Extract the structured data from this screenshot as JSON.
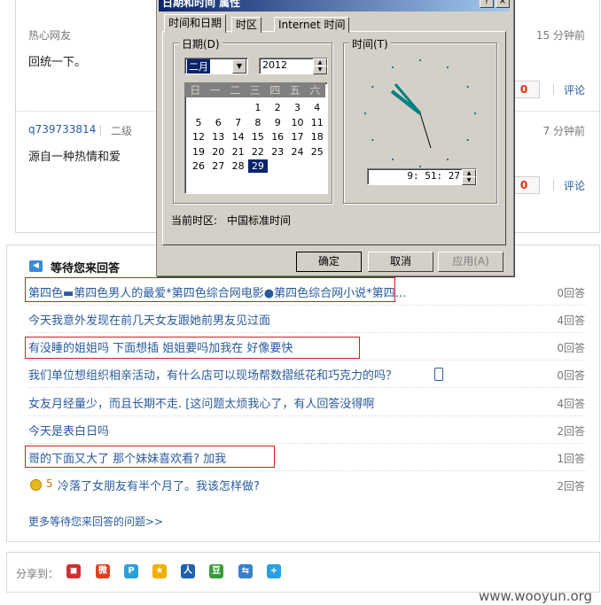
{
  "answers": [
    {
      "user": "热心网友",
      "level": "",
      "time": "15 分钟前",
      "text": "回统一下。",
      "vote": "0",
      "comment": "评论"
    },
    {
      "user": "q739733814",
      "level": "二级",
      "time": "7 分钟前",
      "text": "源自一种热情和爱",
      "vote": "0",
      "comment": "评论"
    }
  ],
  "pending": {
    "title": "等待您来回答",
    "questions": [
      {
        "text": "第四色▬第四色男人的最爱*第四色综合网电影●第四色综合网小说*第四…",
        "count": "0回答"
      },
      {
        "text": "今天我意外发现在前几天女友跟她前男友见过面",
        "count": "4回答"
      },
      {
        "text": "有没睡的姐姐吗 下面想插 姐姐要吗加我在 好像要快",
        "count": "0回答"
      },
      {
        "text": "我们单位想组织相亲活动，有什么店可以现场帮数摺纸花和巧克力的吗？",
        "count": "0回答"
      },
      {
        "text": "女友月经量少，而且长期不走. [这问题太烦我心了，有人回答没得啊",
        "count": "4回答"
      },
      {
        "text": "今天是表白日吗",
        "count": "2回答"
      },
      {
        "text": "哥的下面又大了 那个妹妹喜欢看? 加我",
        "count": "1回答"
      },
      {
        "text": "冷落了女朋友有半个月了。我该怎样做?",
        "count": "2回答",
        "reward": "5"
      }
    ],
    "more": "更多等待您来回答的问题>>"
  },
  "share": {
    "label": "分享到："
  },
  "watermark": "www.wooyun.org",
  "dialog": {
    "title": "日期和时间 属性",
    "tabs": [
      "时间和日期",
      "时区",
      "Internet 时间"
    ],
    "date_group": "日期(D)",
    "time_group": "时间(T)",
    "month": "二月",
    "year": "2012",
    "weekdays": [
      "日",
      "一",
      "二",
      "三",
      "四",
      "五",
      "六"
    ],
    "days": [
      "1",
      "2",
      "3",
      "4",
      "5",
      "6",
      "7",
      "8",
      "9",
      "10",
      "11",
      "12",
      "13",
      "14",
      "15",
      "16",
      "17",
      "18",
      "19",
      "20",
      "21",
      "22",
      "23",
      "24",
      "25",
      "26",
      "27",
      "28",
      "29"
    ],
    "selected_day": "29",
    "time": "9: 51: 27",
    "timezone_label": "当前时区:",
    "timezone": "中国标准时间",
    "ok": "确定",
    "cancel": "取消",
    "apply": "应用(A)",
    "help_btn": "?",
    "close_btn": "×"
  },
  "colors": {
    "link": "#2a5b9c",
    "titlebar": "#0a246a",
    "highlight_box": "#d02020",
    "clock_hand": "#008080"
  }
}
